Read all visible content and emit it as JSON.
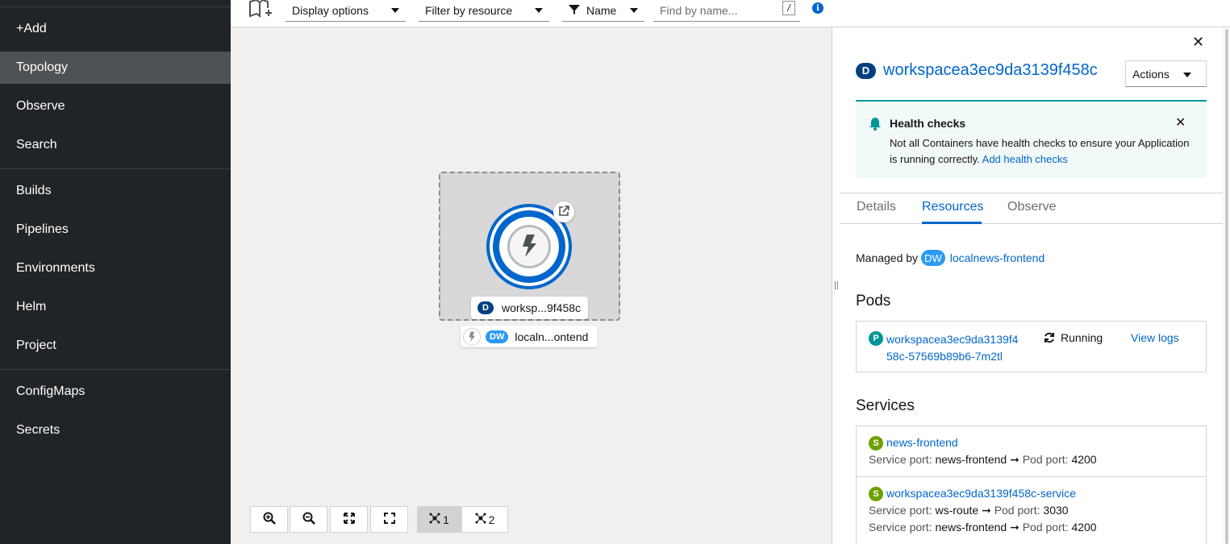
{
  "sidebar": {
    "items": [
      {
        "label": "+Add"
      },
      {
        "label": "Topology"
      },
      {
        "label": "Observe"
      },
      {
        "label": "Search"
      },
      {
        "label": "Builds"
      },
      {
        "label": "Pipelines"
      },
      {
        "label": "Environments"
      },
      {
        "label": "Helm"
      },
      {
        "label": "Project"
      },
      {
        "label": "ConfigMaps"
      },
      {
        "label": "Secrets"
      }
    ],
    "active": "Topology"
  },
  "toolbar": {
    "display_options": "Display options",
    "filter_by_resource": "Filter by resource",
    "filter_type": "Name",
    "find_placeholder": "Find by name...",
    "shortcut_key": "/",
    "info_icon": "info-circle-icon"
  },
  "topology": {
    "node_badge": "D",
    "node_label": "worksp...9f458c",
    "group_badge": "DW",
    "group_label": "localn...ontend"
  },
  "controls": {
    "zoom_in": "zoom-in-icon",
    "zoom_out": "zoom-out-icon",
    "fit": "fit-to-screen-icon",
    "expand": "expand-icon",
    "layout1": "1",
    "layout2": "2"
  },
  "panel": {
    "badge": "D",
    "title": "workspacea3ec9da3139f458c",
    "actions_label": "Actions",
    "alert": {
      "title": "Health checks",
      "body": "Not all Containers have health checks to ensure your Application is running correctly.",
      "link": "Add health checks"
    },
    "tabs": [
      {
        "label": "Details"
      },
      {
        "label": "Resources"
      },
      {
        "label": "Observe"
      }
    ],
    "active_tab": "Resources",
    "managed_by_label": "Managed by",
    "managed_badge": "DW",
    "managed_link": "localnews-frontend",
    "pods_title": "Pods",
    "pod": {
      "badge": "P",
      "name_line1": "workspacea3ec9da3139f4",
      "name_line2": "58c-57569b89b6-7m2tl",
      "status": "Running",
      "view_logs": "View logs"
    },
    "services_title": "Services",
    "services": [
      {
        "badge": "S",
        "name": "news-frontend",
        "ports": [
          {
            "service_port_label": "Service port:",
            "service_port": "news-frontend",
            "pod_port_label": "Pod port:",
            "pod_port": "4200"
          }
        ]
      },
      {
        "badge": "S",
        "name": "workspacea3ec9da3139f458c-service",
        "ports": [
          {
            "service_port_label": "Service port:",
            "service_port": "ws-route",
            "pod_port_label": "Pod port:",
            "pod_port": "3030"
          },
          {
            "service_port_label": "Service port:",
            "service_port": "news-frontend",
            "pod_port_label": "Pod port:",
            "pod_port": "4200"
          }
        ]
      }
    ]
  },
  "colors": {
    "sidebar_bg": "#212427",
    "active_nav": "#4f5255",
    "link": "#0066cc",
    "deployment_badge": "#004080",
    "dw_badge": "#2b9af3",
    "pod_badge": "#009596",
    "service_badge": "#6ca100",
    "alert_bg": "#f2f9f9"
  }
}
